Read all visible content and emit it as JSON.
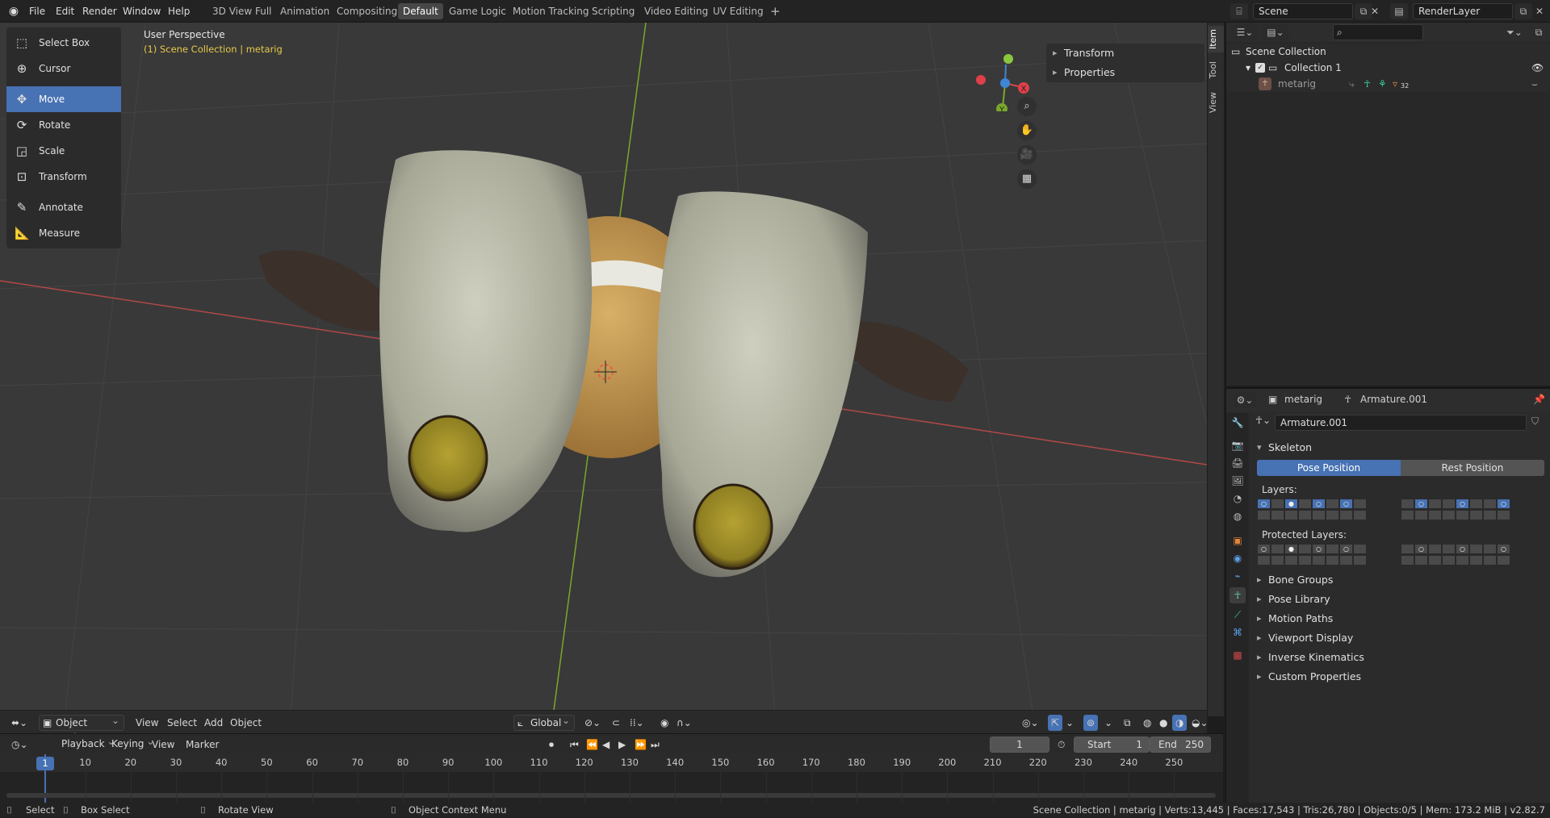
{
  "topbar": {
    "menus": [
      "File",
      "Edit",
      "Render",
      "Window",
      "Help"
    ],
    "workspaces": [
      "3D View Full",
      "Animation",
      "Compositing",
      "Default",
      "Game Logic",
      "Motion Tracking",
      "Scripting",
      "Video Editing",
      "UV Editing"
    ],
    "active_workspace": "Default",
    "scene": "Scene",
    "view_layer": "RenderLayer"
  },
  "toolshelf": {
    "tools": [
      "Select Box",
      "Cursor",
      "Move",
      "Rotate",
      "Scale",
      "Transform",
      "Annotate",
      "Measure"
    ],
    "active": "Move"
  },
  "viewport": {
    "perspective": "User Perspective",
    "collection_info": "(1) Scene Collection | metarig",
    "npanel_items": [
      "Transform",
      "Properties"
    ],
    "side_tabs": [
      "Item",
      "Tool",
      "View"
    ],
    "gizmo_axes": [
      "X",
      "Y"
    ]
  },
  "vp_header": {
    "mode": "Object Mode",
    "menus": [
      "View",
      "Select",
      "Add",
      "Object"
    ],
    "orientation": "Global"
  },
  "timeline_header": {
    "menus": [
      "Playback",
      "Keying",
      "View",
      "Marker"
    ],
    "current_frame": "1",
    "start_label": "Start",
    "start": "1",
    "end_label": "End",
    "end": "250"
  },
  "timeline": {
    "current": "1",
    "ticks": [
      "10",
      "20",
      "30",
      "40",
      "50",
      "60",
      "70",
      "80",
      "90",
      "100",
      "110",
      "120",
      "130",
      "140",
      "150",
      "160",
      "170",
      "180",
      "190",
      "200",
      "210",
      "220",
      "230",
      "240",
      "250"
    ]
  },
  "statusbar": {
    "select": "Select",
    "box_select": "Box Select",
    "rotate_view": "Rotate View",
    "context_menu": "Object Context Menu",
    "stats": "Scene Collection | metarig | Verts:13,445 | Faces:17,543 | Tris:26,780 | Objects:0/5 | Mem: 173.2 MiB | v2.82.7"
  },
  "outliner": {
    "root": "Scene Collection",
    "collection": "Collection 1",
    "object": "metarig",
    "object_badge": "32"
  },
  "properties": {
    "object": "metarig",
    "data": "Armature.001",
    "data_name_field": "Armature.001",
    "skeleton_label": "Skeleton",
    "pose_position": "Pose Position",
    "rest_position": "Rest Position",
    "layers_label": "Layers:",
    "protected_label": "Protected Layers:",
    "sections": [
      "Bone Groups",
      "Pose Library",
      "Motion Paths",
      "Viewport Display",
      "Inverse Kinematics",
      "Custom Properties"
    ]
  },
  "colors": {
    "accent": "#4772b3",
    "header_text": "#e6c94a",
    "axis_x": "#e04040",
    "axis_y": "#7fb520"
  }
}
